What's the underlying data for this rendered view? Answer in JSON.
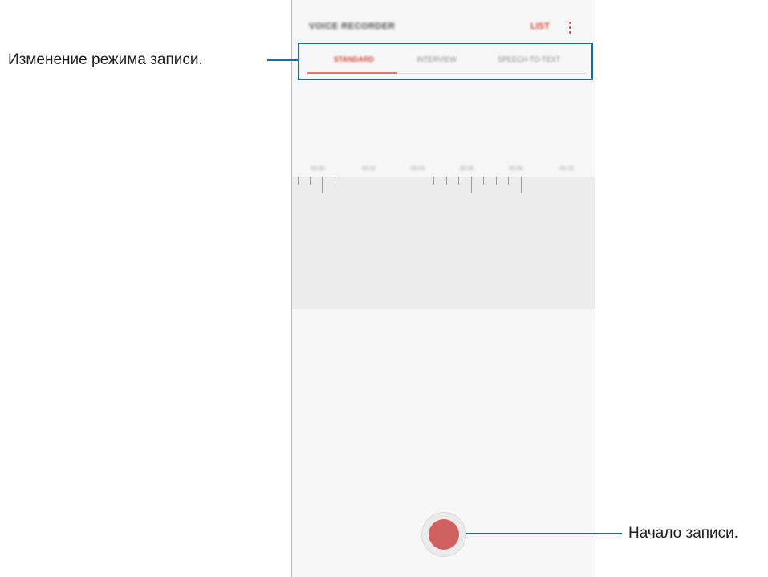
{
  "app": {
    "title": "VOICE RECORDER",
    "list_label": "LIST",
    "more_icon": "more-vertical-icon"
  },
  "tabs": [
    {
      "label": "STANDARD",
      "active": true
    },
    {
      "label": "INTERVIEW",
      "active": false
    },
    {
      "label": "SPEECH-TO-TEXT",
      "active": false
    }
  ],
  "timeline": {
    "labels": [
      "00:00",
      "00:02",
      "00:04",
      "00:06",
      "00:08",
      "00:10"
    ]
  },
  "record": {
    "icon": "record-icon"
  },
  "callouts": {
    "mode_change": "Изменение режима записи.",
    "start_recording": "Начало записи."
  },
  "colors": {
    "accent": "#d34a3c",
    "record": "#d16060",
    "callout": "#1a6f9f"
  }
}
